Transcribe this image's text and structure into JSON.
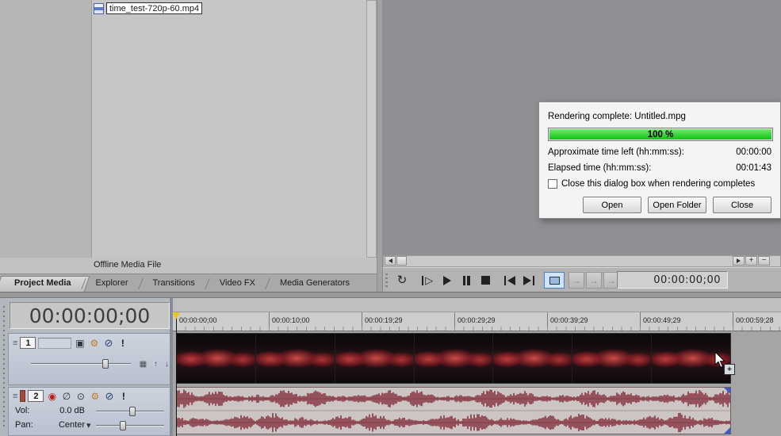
{
  "media_panel": {
    "file_name": "time_test-720p-60.mp4",
    "status_text": "Offline Media File"
  },
  "tab_bar": {
    "tabs": [
      {
        "label": "Project Media"
      },
      {
        "label": "Explorer"
      },
      {
        "label": "Transitions"
      },
      {
        "label": "Video FX"
      },
      {
        "label": "Media Generators"
      }
    ]
  },
  "render_dialog": {
    "title": "Rendering complete: Untitled.mpg",
    "progress_text": "100 %",
    "progress_percent": 100,
    "approx_label": "Approximate time left (hh:mm:ss):",
    "approx_value": "00:00:00",
    "elapsed_label": "Elapsed time (hh:mm:ss):",
    "elapsed_value": "00:01:43",
    "checkbox_label": "Close this dialog box when rendering completes",
    "checkbox_checked": false,
    "buttons": {
      "open": "Open",
      "open_folder": "Open Folder",
      "close": "Close"
    }
  },
  "transport": {
    "timecode": "00:00:00;00"
  },
  "timeline": {
    "current_timecode": "00:00:00;00",
    "ruler_ticks": [
      "00:00:00;00",
      "00:00:10;00",
      "00:00:19;29",
      "00:00:29;29",
      "00:00:39;29",
      "00:00:49;29",
      "00:00:59;28"
    ],
    "video_track": {
      "number": "1"
    },
    "audio_track": {
      "number": "2",
      "vol_label": "Vol:",
      "vol_value": "0.0 dB",
      "pan_label": "Pan:",
      "pan_value": "Center"
    }
  },
  "icons": {
    "drag_handle": "≡",
    "track_motion": "▣",
    "gear": "⚙",
    "mute": "⊘",
    "solo": "!",
    "record_arm": "◉",
    "phase_invert": "∅",
    "track_fx": "⊙",
    "compositing": "▦",
    "up": "↑",
    "down": "↓",
    "loop": "↻",
    "play_outline": "▷",
    "caret_down": "▾",
    "step_arrow": "→",
    "plus": "+",
    "minus": "−"
  },
  "colors": {
    "progress_green": "#2ed52e",
    "waveform": "#7c2230",
    "cursor_yellow": "#e8c51d"
  }
}
